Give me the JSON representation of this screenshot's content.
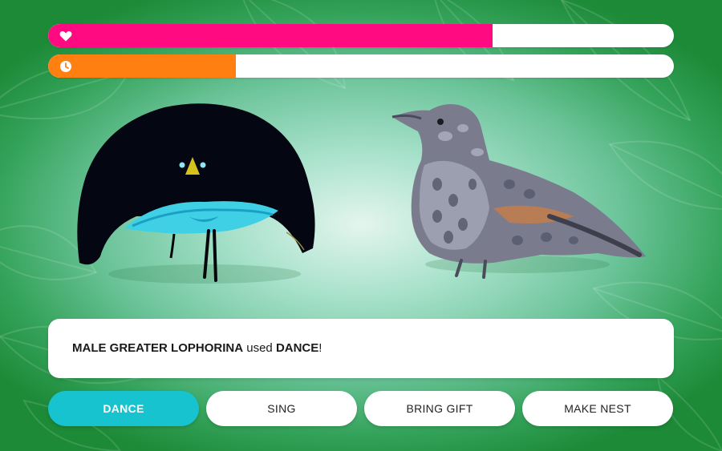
{
  "colors": {
    "health": "#ff0a80",
    "time": "#ff8010",
    "accent": "#17c3cf",
    "background_center": "#e4f5ee",
    "background_edge": "#1d8a38"
  },
  "health_bar": {
    "icon": "heart-icon",
    "fill_percent": 71
  },
  "time_bar": {
    "icon": "clock-icon",
    "fill_percent": 30
  },
  "message": {
    "actor": "MALE GREATER LOPHORINA",
    "verb": " used ",
    "move": "DANCE",
    "end": "!"
  },
  "actions": [
    {
      "label": "DANCE",
      "active": true
    },
    {
      "label": "SING",
      "active": false
    },
    {
      "label": "BRING GIFT",
      "active": false
    },
    {
      "label": "MAKE NEST",
      "active": false
    }
  ]
}
